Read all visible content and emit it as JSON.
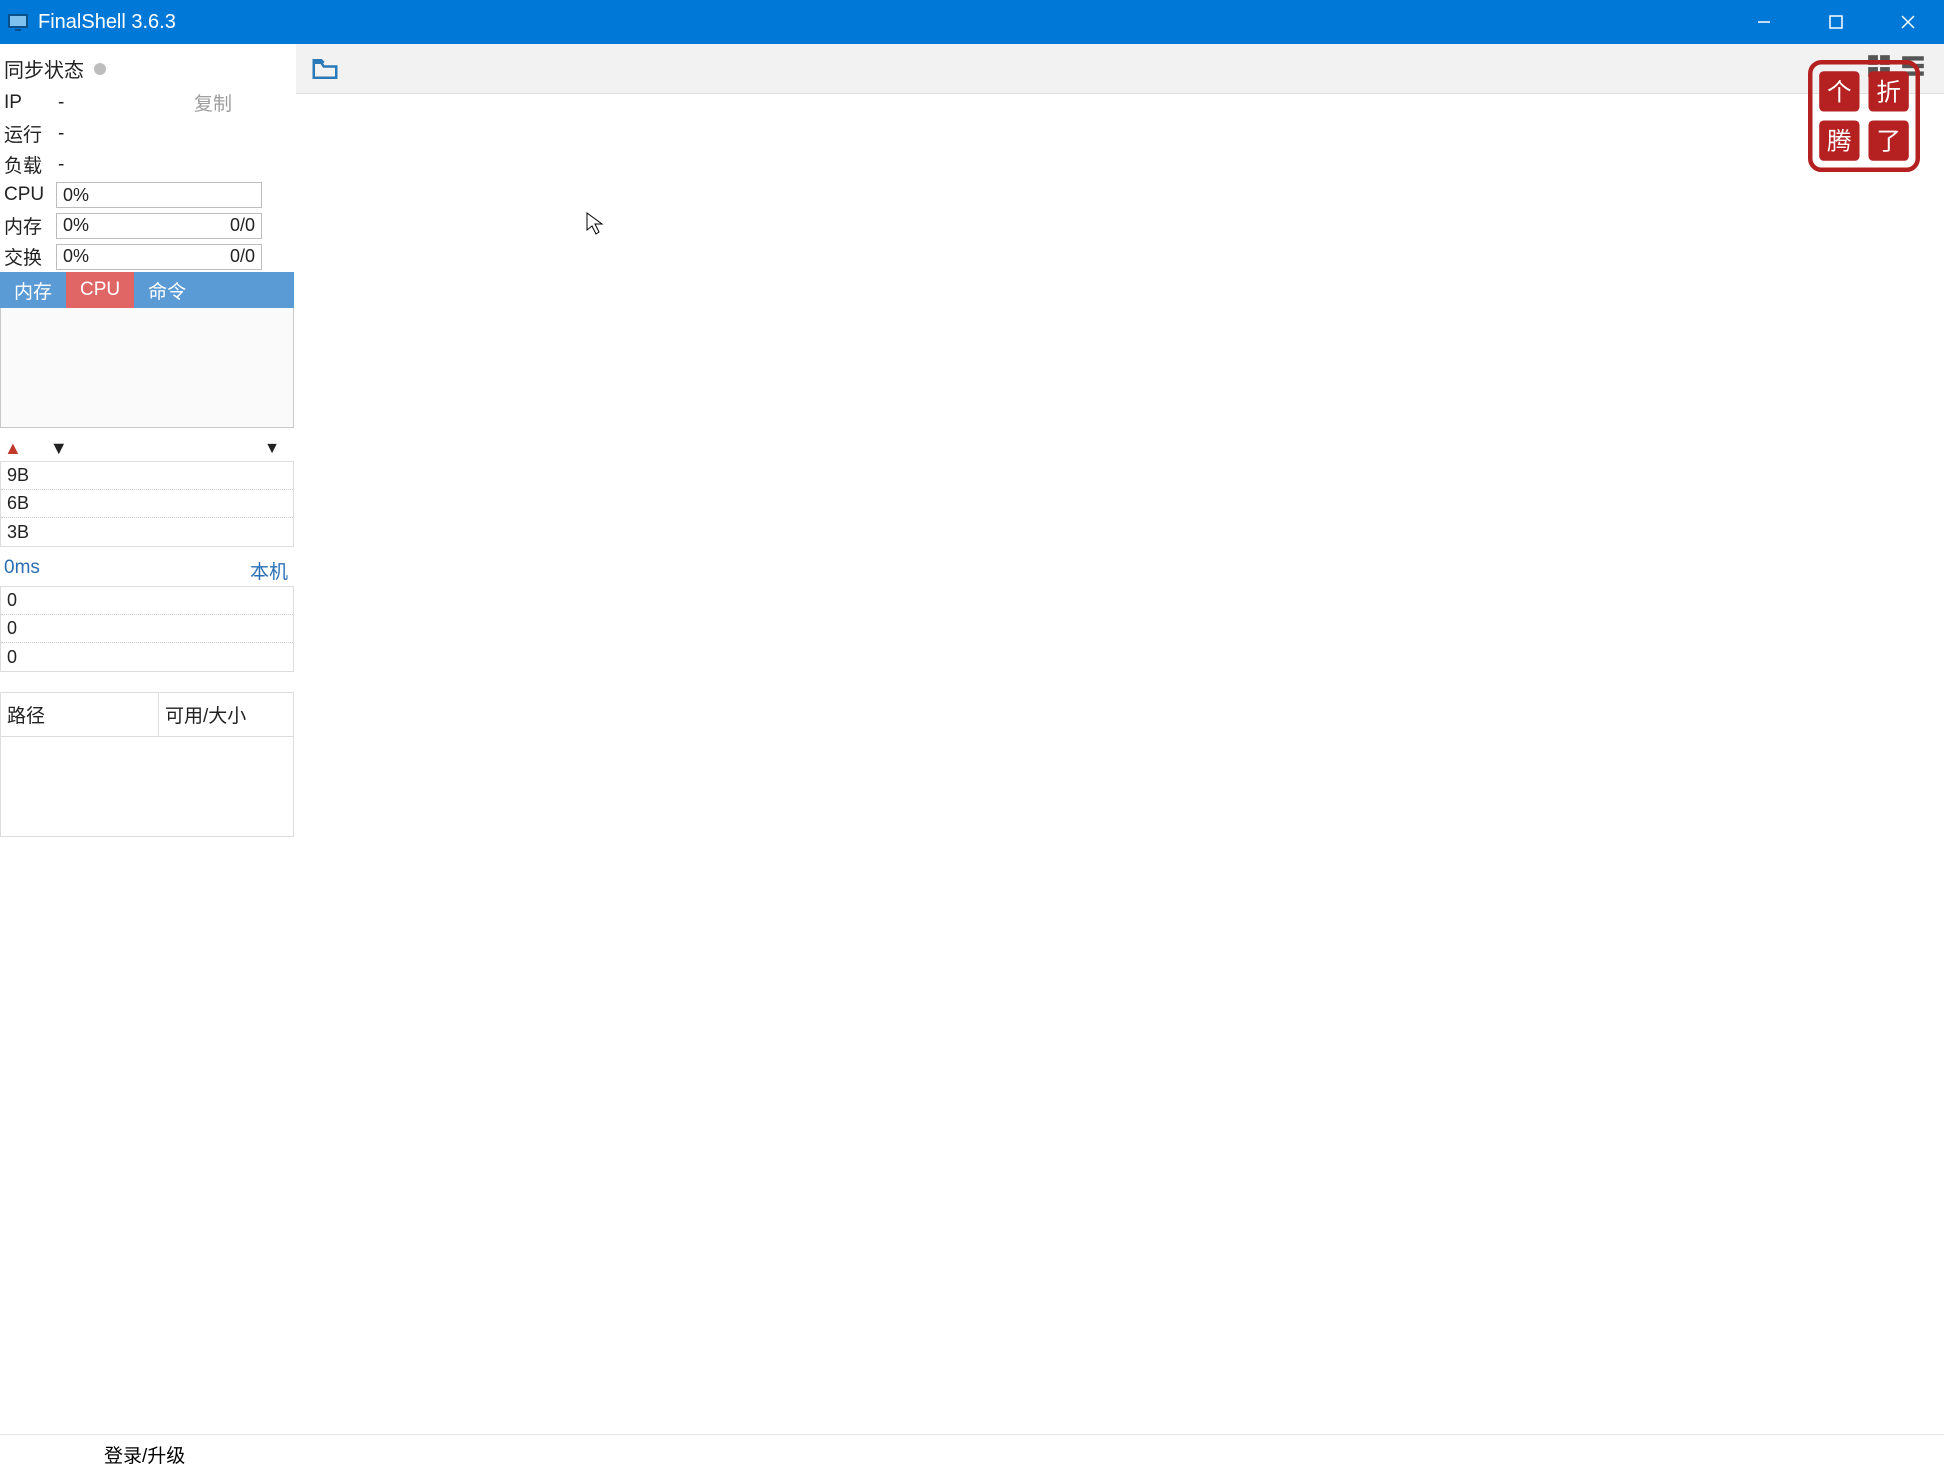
{
  "titlebar": {
    "title": "FinalShell 3.6.3"
  },
  "sidebar": {
    "sync_label": "同步状态",
    "ip_label": "IP",
    "ip_value": "-",
    "copy_label": "复制",
    "run_label": "运行",
    "run_value": "-",
    "load_label": "负载",
    "load_value": "-",
    "cpu_label": "CPU",
    "cpu_pct": "0%",
    "mem_label": "内存",
    "mem_pct": "0%",
    "mem_ratio": "0/0",
    "swap_label": "交换",
    "swap_pct": "0%",
    "swap_ratio": "0/0",
    "tabs": {
      "mem": "内存",
      "cpu": "CPU",
      "cmd": "命令"
    },
    "net_rows": [
      "9B",
      "6B",
      "3B"
    ],
    "ping_left": "0ms",
    "ping_right": "本机",
    "ping_rows": [
      "0",
      "0",
      "0"
    ],
    "table": {
      "col1": "路径",
      "col2": "可用/大小"
    }
  },
  "statusbar": {
    "login": "登录/升级"
  }
}
